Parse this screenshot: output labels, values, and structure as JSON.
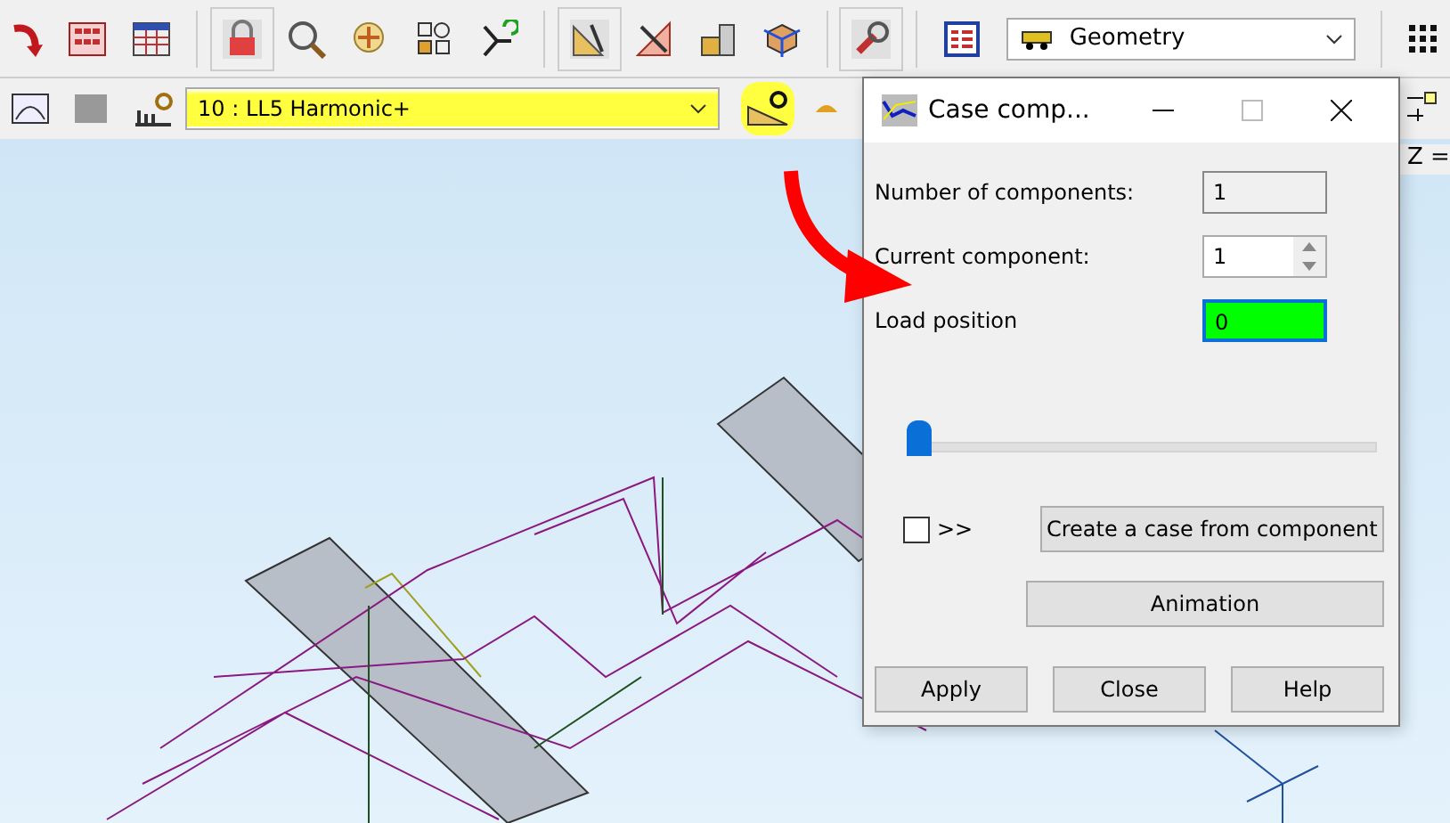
{
  "toolbar": {
    "view_dropdown": {
      "value": "Geometry"
    }
  },
  "load_toolbar": {
    "case_dropdown": {
      "value": "10 : LL5 Harmonic+",
      "highlighted": true
    },
    "case_button": {
      "highlighted": true
    }
  },
  "viewport": {
    "coordinate_label": "Z ="
  },
  "dialog": {
    "title": "Case comp...",
    "fields": [
      {
        "label": "Number of components:",
        "value": "1",
        "kind": "readonly"
      },
      {
        "label": "Current component:",
        "value": "1",
        "kind": "spinner"
      },
      {
        "label": "Load position",
        "value": "0",
        "kind": "highlight"
      }
    ],
    "slider": {
      "level": 0
    },
    "checkbox": {
      "label": ">>",
      "checked": false
    },
    "action_buttons": [
      "Create a case from component",
      "Animation"
    ],
    "buttons": [
      "Apply",
      "Close",
      "Help"
    ]
  }
}
